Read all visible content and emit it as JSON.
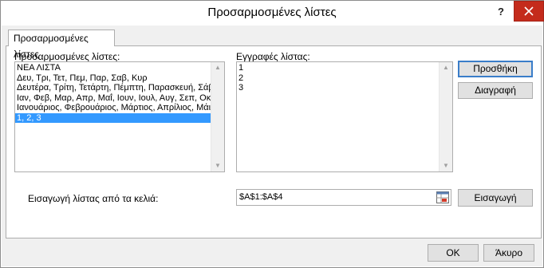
{
  "window": {
    "title": "Προσαρμοσμένες λίστες",
    "help_label": "?"
  },
  "tab": {
    "label": "Προσαρμοσμένες λίστες"
  },
  "custom_lists": {
    "label": "Προσαρμοσμένες λίστες:",
    "items": [
      "ΝΕΑ ΛΙΣΤΑ",
      "Δευ, Τρι, Τετ, Πεμ, Παρ, Σαβ, Κυρ",
      "Δευτέρα, Τρίτη, Τετάρτη, Πέμπτη, Παρασκευή, Σάββατο",
      "Ιαν, Φεβ, Μαρ, Απρ, Μαΐ, Ιουν, Ιουλ, Αυγ, Σεπ, Οκτ, Νοε,",
      "Ιανουάριος, Φεβρουάριος, Μάρτιος, Απρίλιος, Μάιος, Ιο",
      "1, 2, 3"
    ],
    "selected_index": 5
  },
  "list_entries": {
    "label": "Εγγραφές λίστας:",
    "items": [
      "1",
      "2",
      "3"
    ]
  },
  "buttons": {
    "add": "Προσθήκη",
    "delete": "Διαγραφή",
    "import": "Εισαγωγή",
    "ok": "OK",
    "cancel": "Άκυρο"
  },
  "import_range": {
    "label": "Εισαγωγή λίστας από τα κελιά:",
    "value": "$A$1:$A$4"
  },
  "colors": {
    "selection": "#3399ff",
    "close_button": "#c42b1c",
    "dialog_background": "#f0f0f0"
  }
}
